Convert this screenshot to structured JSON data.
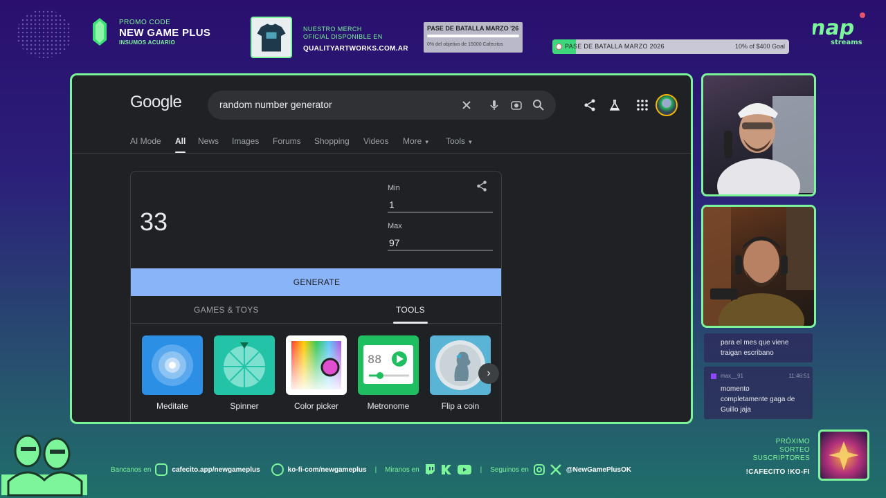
{
  "overlay": {
    "promo": {
      "label": "PROMO CODE",
      "code": "NEW GAME PLUS",
      "sub": "INSUMOS ACUARIO"
    },
    "merch": {
      "line1": "NUESTRO MERCH",
      "line2": "OFICIAL DISPONIBLE EN",
      "site": "QUALITYARTWORKS.COM.AR"
    },
    "goal_small": {
      "title": "PASE DE BATALLA MARZO '26",
      "sub": "0% del objetivo de 15000 Cafecitos",
      "progress": 0
    },
    "goal_bar": {
      "title": "PASE DE BATALLA MARZO 2026",
      "right": "10% of $400 Goal",
      "progress": 0.1
    },
    "logo_sub": "streams",
    "chat": [
      {
        "text": "para el mes que viene traigan escribano"
      },
      {
        "user": "max__91",
        "time": "11:46:51",
        "text": "momento completamente gaga de Guillo jaja"
      }
    ],
    "bottom": {
      "bancanos_label": "Bancanos en",
      "cafecito": "cafecito.app/newgameplus",
      "kofi": "ko-fi-com/newgameplus",
      "miranos_label": "Miranos en",
      "seguinos_label": "Seguinos en",
      "handle": "@NewGamePlusOK"
    },
    "sorteo": {
      "l1": "PRÓXIMO",
      "l2": "SORTEO",
      "l3": "SUSCRIPTORES",
      "cmd": "!CAFECITO  !KO-FI"
    }
  },
  "google": {
    "logo": "Google",
    "query": "random number generator",
    "tabs": [
      "AI Mode",
      "All",
      "News",
      "Images",
      "Forums",
      "Shopping",
      "Videos",
      "More",
      "Tools"
    ],
    "active_tab": "All",
    "rng": {
      "result": "33",
      "min_label": "Min",
      "min_value": "1",
      "max_label": "Max",
      "max_value": "97",
      "generate_label": "GENERATE",
      "subtabs": [
        "GAMES & TOYS",
        "TOOLS"
      ],
      "active_subtab": "TOOLS",
      "tools": [
        {
          "name": "Meditate",
          "color": "#2b8fe6"
        },
        {
          "name": "Spinner",
          "color": "#22c3a6"
        },
        {
          "name": "Color picker",
          "color": "#ffffff"
        },
        {
          "name": "Metronome",
          "color": "#1fbe60"
        },
        {
          "name": "Flip a coin",
          "color": "#5ab4d6"
        }
      ],
      "metronome_bpm": "88"
    }
  },
  "colors": {
    "accent": "#7df59a",
    "google_blue": "#8ab4f8",
    "bg_dark": "#202124"
  }
}
